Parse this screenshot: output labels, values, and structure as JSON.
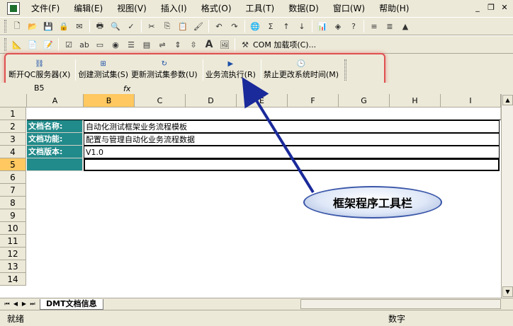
{
  "menu": [
    "文件(F)",
    "编辑(E)",
    "视图(V)",
    "插入(I)",
    "格式(O)",
    "工具(T)",
    "数据(D)",
    "窗口(W)",
    "帮助(H)"
  ],
  "toolbar2": {
    "com_addins_label": "COM 加载项(C)..."
  },
  "framework_toolbar": {
    "buttons": [
      "断开QC服务器(X)",
      "创建测试集(S)",
      "更新测试集参数(U)",
      "业务流执行(R)",
      "禁止更改系统时间(M)"
    ]
  },
  "formula": {
    "namebox": "B5",
    "fx": "fx"
  },
  "columns": [
    "A",
    "B",
    "C",
    "D",
    "E",
    "F",
    "G",
    "H",
    "I"
  ],
  "rows": [
    "1",
    "2",
    "3",
    "4",
    "5",
    "6",
    "7",
    "8",
    "9",
    "10",
    "11",
    "12",
    "13",
    "14"
  ],
  "cells": {
    "r2_label": "文档名称:",
    "r2_value": "自动化测试框架业务流程模板",
    "r3_label": "文档功能:",
    "r3_value": "配置与管理自动化业务流程数据",
    "r4_label": "文档版本:",
    "r4_value": "V1.0"
  },
  "sheet_tab": "DMT文档信息",
  "status": {
    "ready": "就绪",
    "mode": "数字"
  },
  "callout": "框架程序工具栏",
  "colors": {
    "label_bg": "#218a8a",
    "highlight": "#e05050",
    "arrow": "#1a2a9a"
  }
}
